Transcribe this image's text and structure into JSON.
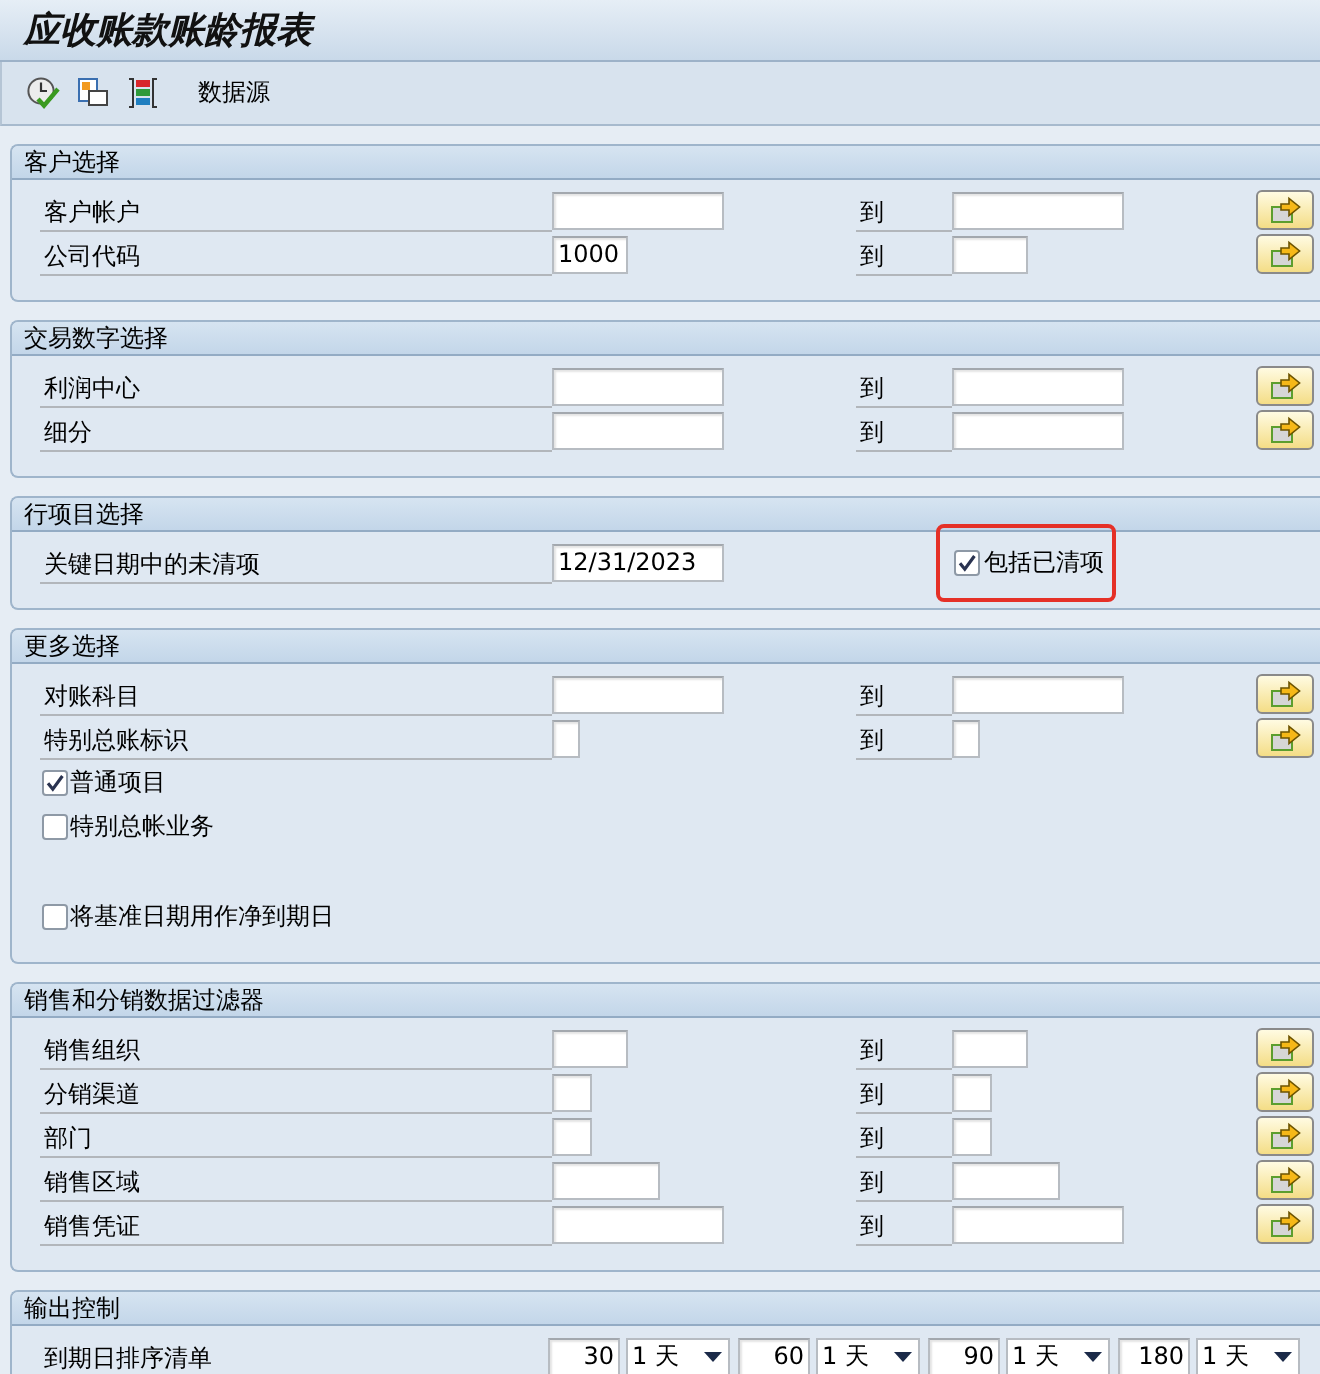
{
  "window": {
    "title": "应收账款账龄报表"
  },
  "toolbar": {
    "data_source_button": "数据源"
  },
  "sections": [
    {
      "title": "客户选择",
      "rows": [
        {
          "kind": "range",
          "label": "客户帐户",
          "to_label": "到"
        },
        {
          "kind": "range",
          "label": "公司代码",
          "value": "1000",
          "to_label": "到"
        }
      ]
    },
    {
      "title": "交易数字选择",
      "rows": [
        {
          "kind": "range",
          "label": "利润中心",
          "to_label": "到"
        },
        {
          "kind": "range",
          "label": "细分",
          "to_label": "到"
        }
      ]
    },
    {
      "title": "行项目选择",
      "rows": [
        {
          "kind": "parameter",
          "label": "关键日期中的未清项",
          "value": "12/31/2023",
          "checkbox": {
            "label": "包括已清项",
            "checked": true,
            "highlighted": true
          }
        }
      ]
    },
    {
      "title": "更多选择",
      "rows": [
        {
          "kind": "range",
          "label": "对账科目",
          "to_label": "到"
        },
        {
          "kind": "range",
          "label": "特别总账标识",
          "to_label": "到"
        },
        {
          "kind": "checkbox",
          "label": "普通项目",
          "checked": true
        },
        {
          "kind": "checkbox",
          "label": "特别总帐业务",
          "checked": false
        },
        {
          "kind": "blank"
        },
        {
          "kind": "checkbox",
          "label": "将基准日期用作净到期日",
          "checked": false
        }
      ]
    },
    {
      "title": "销售和分销数据过滤器",
      "rows": [
        {
          "kind": "range",
          "label": "销售组织",
          "to_label": "到"
        },
        {
          "kind": "range",
          "label": "分销渠道",
          "to_label": "到"
        },
        {
          "kind": "range",
          "label": "部门",
          "to_label": "到"
        },
        {
          "kind": "range",
          "label": "销售区域",
          "to_label": "到"
        },
        {
          "kind": "range",
          "label": "销售凭证",
          "to_label": "到"
        }
      ]
    },
    {
      "title": "输出控制",
      "rows": [
        {
          "kind": "intervals",
          "label": "到期日排序清单",
          "intervals": [
            {
              "value": "30",
              "unit": "1 天"
            },
            {
              "value": "60",
              "unit": "1 天"
            },
            {
              "value": "90",
              "unit": "1 天"
            },
            {
              "value": "180",
              "unit": "1 天"
            }
          ]
        }
      ]
    }
  ]
}
